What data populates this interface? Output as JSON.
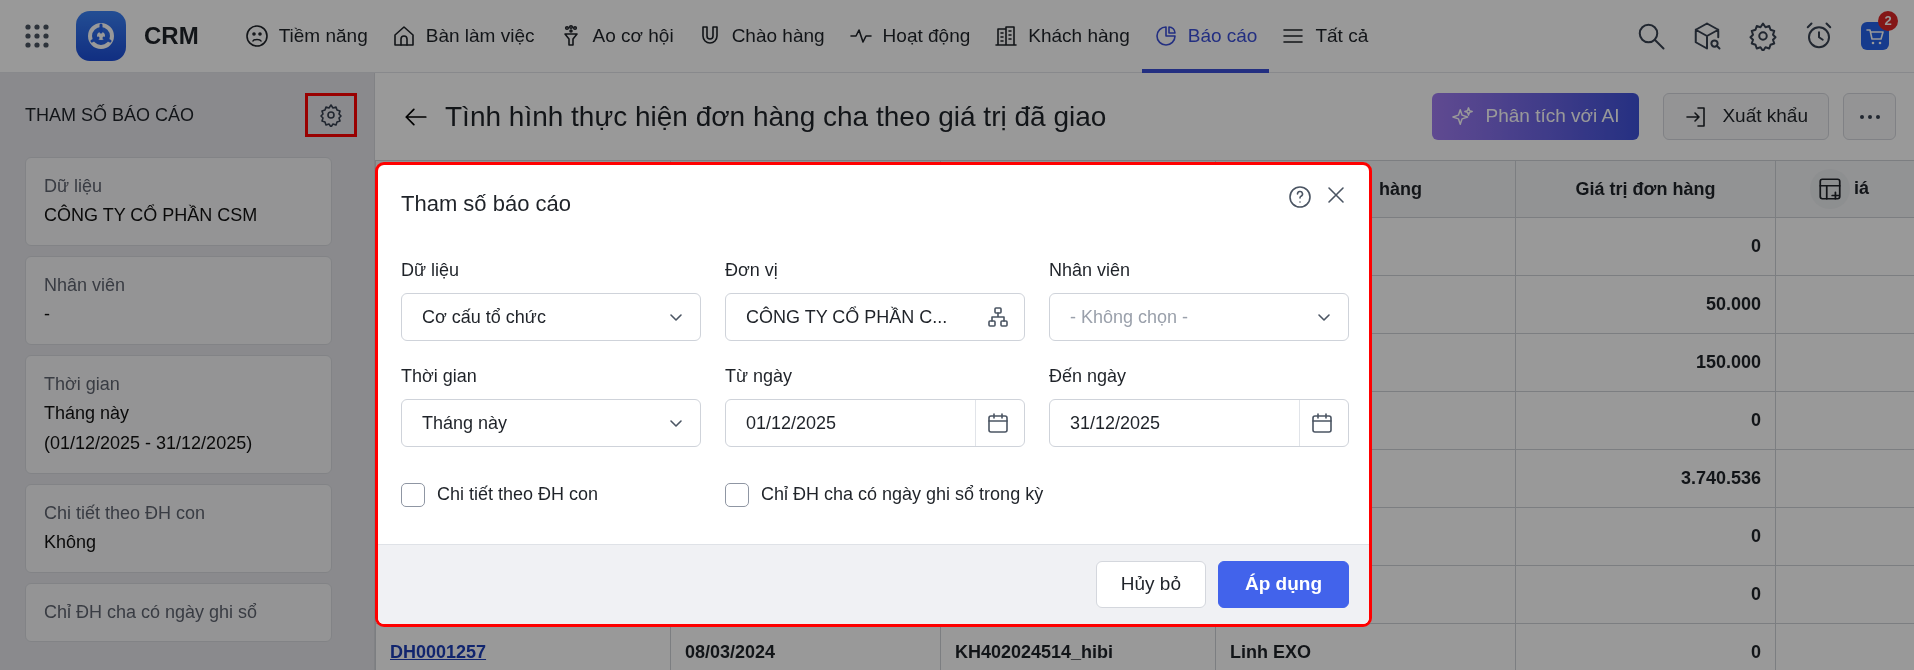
{
  "nav": {
    "app_name": "CRM",
    "cart_badge": "2",
    "items": [
      {
        "label": "Tiềm năng",
        "selected": false
      },
      {
        "label": "Bàn làm việc",
        "selected": false
      },
      {
        "label": "Ao cơ hội",
        "selected": false
      },
      {
        "label": "Chào hàng",
        "selected": false
      },
      {
        "label": "Hoạt động",
        "selected": false
      },
      {
        "label": "Khách hàng",
        "selected": false
      },
      {
        "label": "Báo cáo",
        "selected": true
      },
      {
        "label": "Tất cả",
        "selected": false
      }
    ]
  },
  "sidebar": {
    "title": "THAM SỐ BÁO CÁO",
    "cards": [
      {
        "label": "Dữ liệu",
        "values": [
          "CÔNG TY CỔ PHẦN CSM"
        ]
      },
      {
        "label": "Nhân viên",
        "values": [
          "-"
        ]
      },
      {
        "label": "Thời gian",
        "values": [
          "Tháng này",
          "(01/12/2025 - 31/12/2025)"
        ]
      },
      {
        "label": "Chi tiết theo ĐH con",
        "values": [
          "Không"
        ]
      },
      {
        "label": "Chỉ ĐH cha có ngày ghi sổ"
      }
    ]
  },
  "report": {
    "title": "Tình hình thực hiện đơn hàng cha theo giá trị đã giao",
    "buttons": [
      {
        "label": "Phân tích với AI",
        "kind": "ai"
      },
      {
        "label": "Xuất khẩu",
        "kind": "export"
      },
      {
        "kind": "more"
      }
    ]
  },
  "table": {
    "columns": [
      null,
      null,
      null,
      "hàng",
      "Giá trị đơn hàng",
      "iá"
    ],
    "rows": [
      [
        null,
        null,
        null,
        null,
        "0",
        null
      ],
      [
        null,
        null,
        null,
        null,
        "50.000",
        null
      ],
      [
        null,
        null,
        null,
        null,
        "150.000",
        null
      ],
      [
        null,
        null,
        null,
        null,
        "0",
        null
      ],
      [
        null,
        null,
        null,
        null,
        "3.740.536",
        null
      ],
      [
        null,
        null,
        null,
        null,
        "0",
        null
      ],
      [
        null,
        null,
        null,
        null,
        "0",
        null
      ],
      [
        "DH0001257",
        "08/03/2024",
        "KH402024514_hibi",
        "Linh EXO",
        "0",
        null
      ]
    ]
  },
  "dialog": {
    "title": "Tham số báo cáo",
    "fields": [
      {
        "label": "Dữ liệu",
        "kind": "select",
        "value": "Cơ cấu tổ chức"
      },
      {
        "label": "Đơn vị",
        "kind": "tree",
        "value": "CÔNG TY CỔ PHẦN C..."
      },
      {
        "label": "Nhân viên",
        "kind": "select",
        "placeholder": "- Không chọn -"
      },
      {
        "label": "Thời gian",
        "kind": "select",
        "value": "Tháng này"
      },
      {
        "label": "Từ ngày",
        "kind": "date",
        "value": "01/12/2025"
      },
      {
        "label": "Đến ngày",
        "kind": "date",
        "value": "31/12/2025"
      }
    ],
    "checkboxes": [
      {
        "label": "Chi tiết theo ĐH con",
        "checked": false
      },
      {
        "label": "Chỉ ĐH cha có ngày ghi sổ trong kỳ",
        "checked": false
      }
    ],
    "buttons": [
      {
        "label": "Hủy bỏ",
        "kind": "secondary"
      },
      {
        "label": "Áp dụng",
        "kind": "primary"
      }
    ]
  }
}
